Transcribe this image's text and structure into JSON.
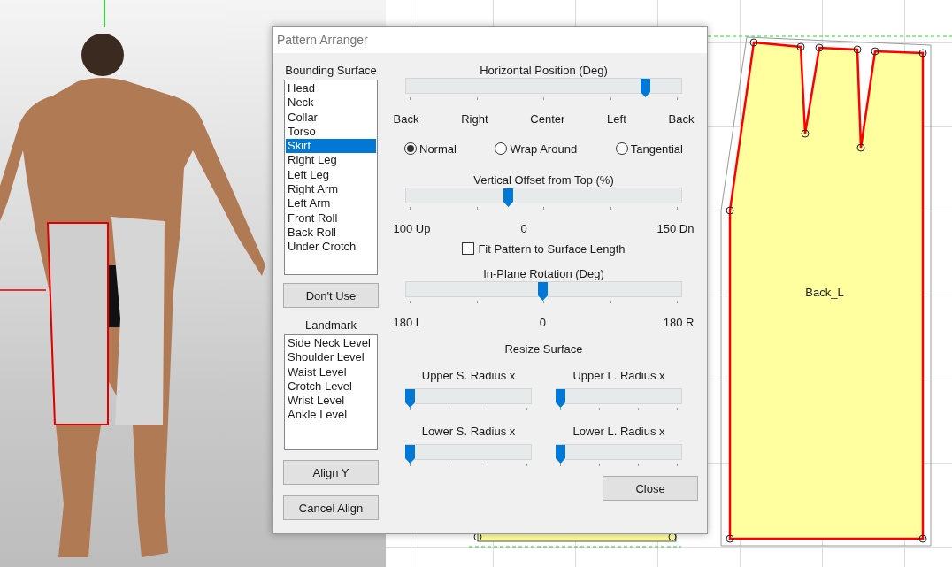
{
  "dialog": {
    "title": "Pattern Arranger",
    "bounding_surface": {
      "label": "Bounding Surface",
      "items": [
        {
          "label": "Head",
          "selected": false
        },
        {
          "label": "Neck",
          "selected": false
        },
        {
          "label": "Collar",
          "selected": false
        },
        {
          "label": "Torso",
          "selected": false
        },
        {
          "label": "Skirt",
          "selected": true
        },
        {
          "label": "Right Leg",
          "selected": false
        },
        {
          "label": "Left Leg",
          "selected": false
        },
        {
          "label": "Right Arm",
          "selected": false
        },
        {
          "label": "Left Arm",
          "selected": false
        },
        {
          "label": "Front Roll",
          "selected": false
        },
        {
          "label": "Back Roll",
          "selected": false
        },
        {
          "label": "Under Crotch",
          "selected": false
        }
      ]
    },
    "dont_use_button": "Don't Use",
    "landmark": {
      "label": "Landmark",
      "items": [
        {
          "label": "Side Neck Level"
        },
        {
          "label": "Shoulder Level"
        },
        {
          "label": "Waist Level"
        },
        {
          "label": "Crotch Level"
        },
        {
          "label": "Wrist Level"
        },
        {
          "label": "Ankle Level"
        }
      ]
    },
    "align_y_button": "Align Y",
    "cancel_align_button": "Cancel Align",
    "horizontal_position": {
      "title": "Horizontal Position (Deg)",
      "level": 0.89,
      "tick_labels": [
        "Back",
        "Right",
        "Center",
        "Left",
        "Back"
      ]
    },
    "modes": [
      {
        "label": "Normal",
        "selected": true
      },
      {
        "label": "Wrap Around",
        "selected": false
      },
      {
        "label": "Tangential",
        "selected": false
      }
    ],
    "vertical_offset": {
      "title": "Vertical Offset from Top (%)",
      "level": 0.37,
      "tick_labels": [
        "100 Up",
        "0",
        "150 Dn"
      ]
    },
    "fit_checkbox": {
      "label": "Fit Pattern to Surface Length",
      "checked": false
    },
    "rotation": {
      "title": "In-Plane Rotation (Deg)",
      "level": 0.5,
      "tick_labels": [
        "180 L",
        "0",
        "180 R"
      ]
    },
    "resize": {
      "title": "Resize Surface",
      "sliders": [
        {
          "label": "Upper S. Radius x",
          "level": 0
        },
        {
          "label": "Upper L. Radius x",
          "level": 0
        },
        {
          "label": "Lower S. Radius x",
          "level": 0
        },
        {
          "label": "Lower L. Radius x",
          "level": 0
        }
      ]
    },
    "close_button": "Close"
  },
  "pattern": {
    "name": "Back_L"
  }
}
